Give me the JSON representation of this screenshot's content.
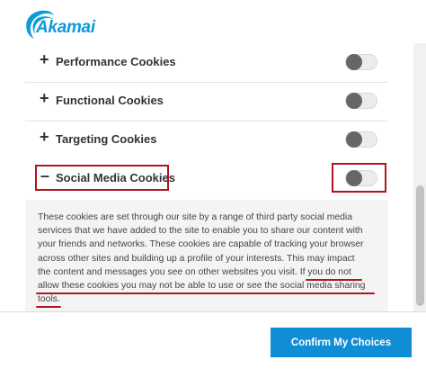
{
  "header": {
    "logo_text": "Akamai"
  },
  "colors": {
    "brand": "#0d9ad8",
    "button": "#0f8ed6",
    "highlight": "#b0161e"
  },
  "cookies": [
    {
      "label": "Performance Cookies",
      "icon": "plus-icon",
      "enabled": false
    },
    {
      "label": "Functional Cookies",
      "icon": "plus-icon",
      "enabled": false
    },
    {
      "label": "Targeting Cookies",
      "icon": "plus-icon",
      "enabled": false
    },
    {
      "label": "Social Media Cookies",
      "icon": "minus-icon",
      "enabled": false,
      "expanded": true
    }
  ],
  "social_media_description": {
    "line1": "These cookies are set through our site by a range of third party social media",
    "line2": "services that we have added to the site to enable you to share our content with",
    "line3": "your friends and networks. These cookies are capable of tracking your browser",
    "line4": "across other sites and building up a profile of your interests. This may impact",
    "line5a": "the content and messages you see on other websites you visit. ",
    "line5b": "If you do not",
    "line6": "allow these cookies you may not be able to use or see the social media sharing",
    "line7": "tools."
  },
  "footer": {
    "confirm_label": "Confirm My Choices"
  }
}
